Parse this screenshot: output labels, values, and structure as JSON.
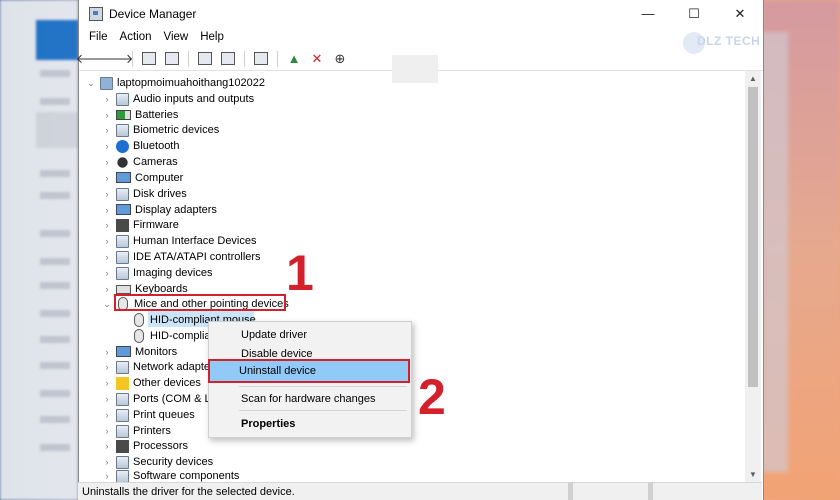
{
  "window": {
    "title": "Device Manager",
    "controls": [
      "—",
      "☐",
      "✕"
    ]
  },
  "menu": [
    "File",
    "Action",
    "View",
    "Help"
  ],
  "logo_text": "DLZ TECH",
  "tree": {
    "root": "laptopmoimuahoithang102022",
    "categories": [
      "Audio inputs and outputs",
      "Batteries",
      "Biometric devices",
      "Bluetooth",
      "Cameras",
      "Computer",
      "Disk drives",
      "Display adapters",
      "Firmware",
      "Human Interface Devices",
      "IDE ATA/ATAPI controllers",
      "Imaging devices",
      "Keyboards",
      "Mice and other pointing devices",
      "HID-compliant mouse",
      "HID-complia",
      "Monitors",
      "Network adapte",
      "Other devices",
      "Ports (COM & LP",
      "Print queues",
      "Printers",
      "Processors",
      "Security devices",
      "Software components"
    ]
  },
  "context_menu": {
    "update": "Update driver",
    "disable": "Disable device",
    "uninstall": "Uninstall device",
    "scan": "Scan for hardware changes",
    "properties": "Properties"
  },
  "annotations": {
    "step1": "1",
    "step2": "2"
  },
  "status": "Uninstalls the driver for the selected device."
}
